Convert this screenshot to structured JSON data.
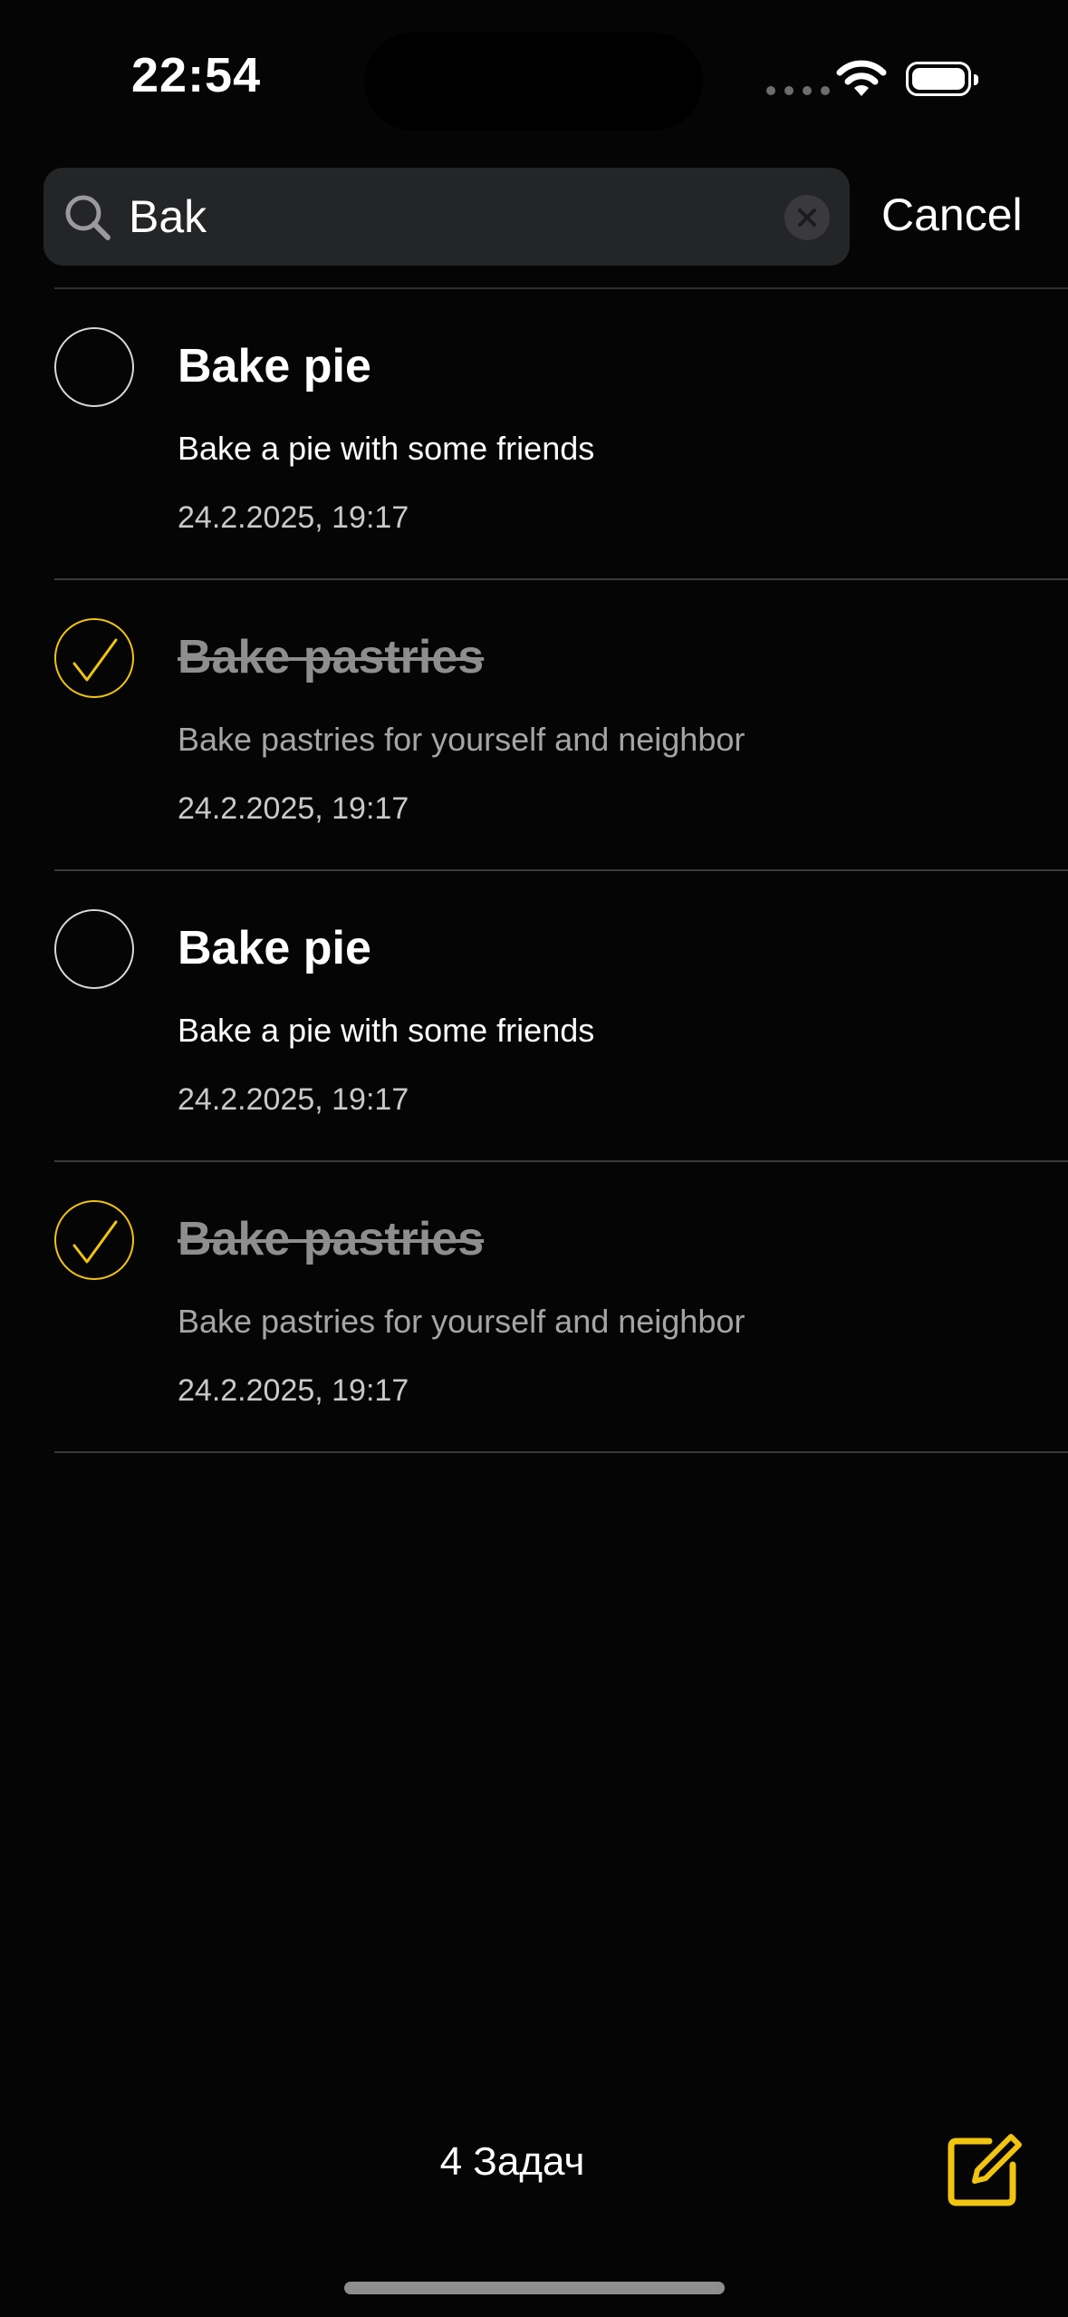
{
  "status_bar": {
    "time": "22:54"
  },
  "search": {
    "value": "Bak",
    "cancel_label": "Cancel"
  },
  "tasks": [
    {
      "title": "Bake pie",
      "description": "Bake a pie with some friends",
      "date": "24.2.2025, 19:17",
      "completed": false
    },
    {
      "title": "Bake pastries",
      "description": "Bake pastries for yourself and neighbor",
      "date": "24.2.2025, 19:17",
      "completed": true
    },
    {
      "title": "Bake pie",
      "description": "Bake a pie with some friends",
      "date": "24.2.2025, 19:17",
      "completed": false
    },
    {
      "title": "Bake pastries",
      "description": "Bake pastries for yourself and neighbor",
      "date": "24.2.2025, 19:17",
      "completed": true
    }
  ],
  "footer": {
    "count_label": "4 Задач"
  },
  "colors": {
    "accent": "#F1C40F",
    "background": "#050505",
    "search_bg": "#242526"
  },
  "icons": {
    "search": "search-icon",
    "clear": "clear-icon",
    "compose": "compose-icon",
    "check": "checkmark-icon"
  }
}
